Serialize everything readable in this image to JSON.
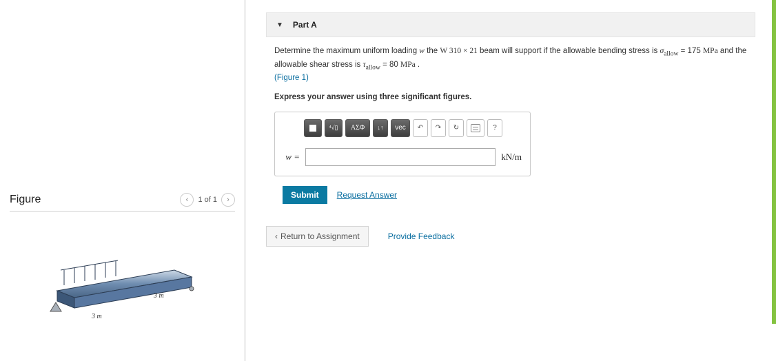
{
  "figure": {
    "title": "Figure",
    "counter": "1 of 1",
    "dim1": "3 m",
    "dim2": "3 m"
  },
  "part": {
    "label": "Part A"
  },
  "problem": {
    "pre_w": "Determine the maximum uniform loading ",
    "w_sym": "w",
    "pre_beam": " the ",
    "beam": "W 310 × 21",
    "post_beam": " beam will support if the allowable bending stress is ",
    "sigma_sub": "allow",
    "sigma_eq": " = 175 ",
    "mpa": "MPa",
    "and_shear": " and the allowable shear stress is ",
    "tau_sub": "allow",
    "tau_eq": " = 80 ",
    "period": " .",
    "figlink": "(Figure 1)",
    "instruction": "Express your answer using three significant figures."
  },
  "toolbar": {
    "greek": "ΑΣΦ",
    "vec": "vec",
    "help": "?"
  },
  "answer": {
    "var": "w",
    "eq": "=",
    "unit": "kN/m"
  },
  "buttons": {
    "submit": "Submit",
    "request": "Request Answer",
    "return": "Return to Assignment",
    "feedback": "Provide Feedback"
  }
}
